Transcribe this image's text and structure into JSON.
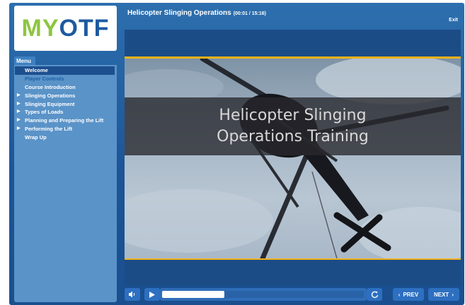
{
  "app": {
    "title": "Helicopter Slinging Operations",
    "time": "(00:01 / 15:16)",
    "exit_label": "Exit"
  },
  "logo": {
    "m": "M",
    "y": "Y",
    "rest": "OTF"
  },
  "sidebar": {
    "menu_label": "Menu",
    "items": [
      {
        "label": "Welcome",
        "expandable": false,
        "state": "active"
      },
      {
        "label": "Player Controls",
        "expandable": false,
        "state": "visited"
      },
      {
        "label": "Course Introduction",
        "expandable": false,
        "state": "normal"
      },
      {
        "label": "Slinging Operations",
        "expandable": true,
        "state": "normal"
      },
      {
        "label": "Slinging Equipment",
        "expandable": true,
        "state": "normal"
      },
      {
        "label": "Types of Loads",
        "expandable": true,
        "state": "normal"
      },
      {
        "label": "Planning and Preparing the Lift",
        "expandable": true,
        "state": "normal"
      },
      {
        "label": "Performing the Lift",
        "expandable": true,
        "state": "normal"
      },
      {
        "label": "Wrap Up",
        "expandable": false,
        "state": "normal"
      }
    ]
  },
  "slide": {
    "line1": "Helicopter Slinging",
    "line2": "Operations Training"
  },
  "controls": {
    "progress_fraction": 0.31,
    "prev_label": "PREV",
    "next_label": "NEXT",
    "volume_icon": "speaker-icon",
    "play_icon": "play-icon",
    "replay_icon": "replay-icon"
  },
  "colors": {
    "brand_green": "#8cc63f",
    "brand_blue": "#1e5aa0",
    "accent_gold": "#f2b21a",
    "active_menu": "#1d4f8f"
  }
}
